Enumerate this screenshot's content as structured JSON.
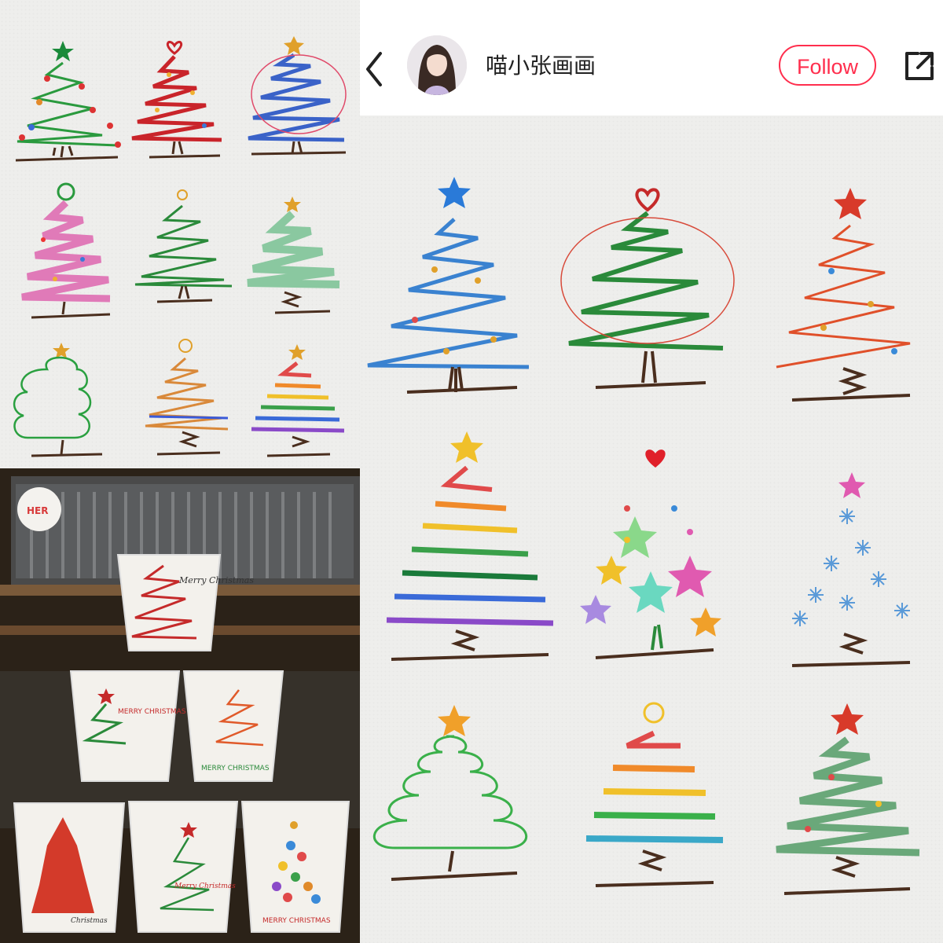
{
  "header": {
    "username": "喵小张画画",
    "follow_label": "Follow",
    "back_icon": "chevron-left-icon",
    "share_icon": "share-icon",
    "colors": {
      "follow": "#ff2e4d",
      "text": "#222222"
    }
  },
  "photo": {
    "sticker_label": "HER",
    "cups": [
      {
        "text": "Merry Christmas"
      },
      {
        "text": "MERRY CHRISTMAS"
      },
      {
        "text": "MERRY CHRISTMAS"
      },
      {
        "text": "Christmas"
      },
      {
        "text": "Merry Christmas"
      },
      {
        "text": "MERRY CHRISTMAS"
      }
    ]
  }
}
